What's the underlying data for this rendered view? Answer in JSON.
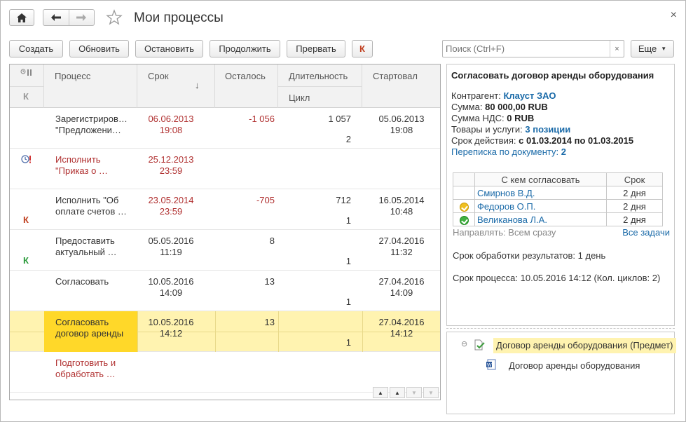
{
  "window": {
    "title": "Мои процессы",
    "close": "×"
  },
  "toolbar": {
    "create": "Создать",
    "refresh": "Обновить",
    "stop": "Остановить",
    "continue": "Продолжить",
    "abort": "Прервать",
    "k": "К",
    "search_placeholder": "Поиск (Ctrl+F)",
    "search_clear": "×",
    "more": "Еще"
  },
  "table": {
    "headers": {
      "k": "К",
      "process": "Процесс",
      "due": "Срок",
      "sort_arrow": "↓",
      "remaining": "Осталось",
      "duration": "Длительность",
      "cycle": "Цикл",
      "started": "Стартовал"
    },
    "rows": [
      {
        "process1": "Зарегистриров…",
        "process2": "\"Предложени…",
        "due1": "06.06.2013",
        "due2": "19:08",
        "remaining": "-1 056",
        "duration": "1 057",
        "cycle": "2",
        "start1": "05.06.2013",
        "start2": "19:08",
        "marker": "",
        "red": false,
        "due_red": true,
        "rem_red": true
      },
      {
        "process1": "Исполнить",
        "process2": "\"Приказ о …",
        "due1": "25.12.2013",
        "due2": "23:59",
        "remaining": "",
        "duration": "",
        "cycle": "",
        "start1": "",
        "start2": "",
        "marker": "clock-alert",
        "red": true,
        "due_red": true,
        "rem_red": false
      },
      {
        "process1": "Исполнить \"Об",
        "process2": "оплате счетов …",
        "due1": "23.05.2014",
        "due2": "23:59",
        "remaining": "-705",
        "duration": "712",
        "cycle": "1",
        "start1": "16.05.2014",
        "start2": "10:48",
        "marker": "К",
        "red": false,
        "due_red": true,
        "rem_red": true
      },
      {
        "process1": "Предоставить",
        "process2": "актуальный …",
        "due1": "05.05.2016",
        "due2": "11:19",
        "remaining": "8",
        "duration": "",
        "cycle": "1",
        "start1": "27.04.2016",
        "start2": "11:32",
        "marker": "К",
        "red": false,
        "due_red": false,
        "rem_red": false
      },
      {
        "process1": "Согласовать",
        "process2": "",
        "due1": "10.05.2016",
        "due2": "14:09",
        "remaining": "13",
        "duration": "",
        "cycle": "1",
        "start1": "27.04.2016",
        "start2": "14:09",
        "marker": "",
        "red": false,
        "due_red": false,
        "rem_red": false
      },
      {
        "process1": "Согласовать",
        "process2": "договор аренды",
        "due1": "10.05.2016",
        "due2": "14:12",
        "remaining": "13",
        "duration": "",
        "cycle": "1",
        "start1": "27.04.2016",
        "start2": "14:12",
        "marker": "",
        "red": false,
        "due_red": false,
        "rem_red": false
      },
      {
        "process1": "Подготовить и",
        "process2": "обработать …",
        "due1": "",
        "due2": "",
        "remaining": "",
        "duration": "",
        "cycle": "",
        "start1": "",
        "start2": "",
        "marker": "",
        "red": true,
        "due_red": false,
        "rem_red": false
      }
    ]
  },
  "details": {
    "title": "Согласовать договор аренды оборудования",
    "counterparty_label": "Контрагент:",
    "counterparty": "Клауст ЗАО",
    "sum_label": "Сумма:",
    "sum": "80 000,00 RUB",
    "vat_label": "Сумма НДС:",
    "vat": "0 RUB",
    "goods_label": "Товары и услуги:",
    "goods": "3 позиции",
    "validity_label": "Срок действия:",
    "validity": "с 01.03.2014 по 01.03.2015",
    "correspondence_label": "Переписка по документу:",
    "correspondence": "2",
    "approval_headers": {
      "who": "С кем согласовать",
      "term": "Срок"
    },
    "approvers": [
      {
        "name": "Смирнов В.Д.",
        "term": "2 дня",
        "status": ""
      },
      {
        "name": "Федоров О.П.",
        "term": "2 дня",
        "status": "pending"
      },
      {
        "name": "Великанова Л.А.",
        "term": "2 дня",
        "status": "done"
      }
    ],
    "send_mode": "Направлять: Всем сразу",
    "all_tasks": "Все задачи",
    "result_term": "Срок обработки результатов: 1 день",
    "process_term": "Срок процесса: 10.05.2016 14:12 (Кол. циклов: 2)"
  },
  "subjects": {
    "item": "Договор аренды оборудования (Предмет)",
    "file": "Договор аренды оборудования"
  }
}
